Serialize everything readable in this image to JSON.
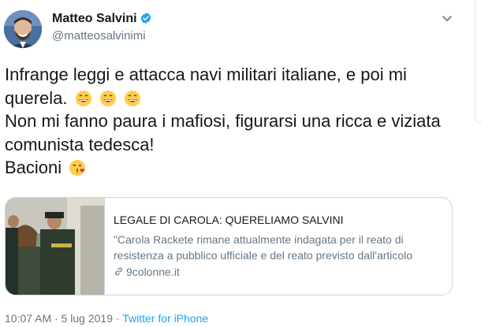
{
  "user": {
    "name": "Matteo Salvini",
    "handle": "@matteosalvinimi"
  },
  "tweet": {
    "lines": [
      "Infrange leggi e attacca navi militari italiane, e poi mi",
      "querela.",
      "Non mi fanno paura i mafiosi, figurarsi una ricca e viziata",
      "comunista tedesca!",
      "Bacioni"
    ],
    "emojis": [
      "grinning-face-emoji",
      "grinning-face-emoji",
      "grinning-face-emoji",
      "kissing-face-emoji"
    ]
  },
  "card": {
    "title": "LEGALE DI CAROLA: QUERELIAMO SALVINI",
    "description_lines": [
      "\"Carola Rackete rimane attualmente indagata per il reato di",
      "resistenza a pubblico ufficiale e del reato previsto dall'articolo"
    ],
    "domain": "9colonne.it"
  },
  "meta": {
    "time": "10:07 AM",
    "date": "5 lug 2019",
    "separator": "·",
    "source": "Twitter for iPhone"
  },
  "colors": {
    "text": "#14171a",
    "secondary": "#657786",
    "link": "#1da1f2",
    "border": "#ccd6dd",
    "verified": "#1da1f2"
  }
}
